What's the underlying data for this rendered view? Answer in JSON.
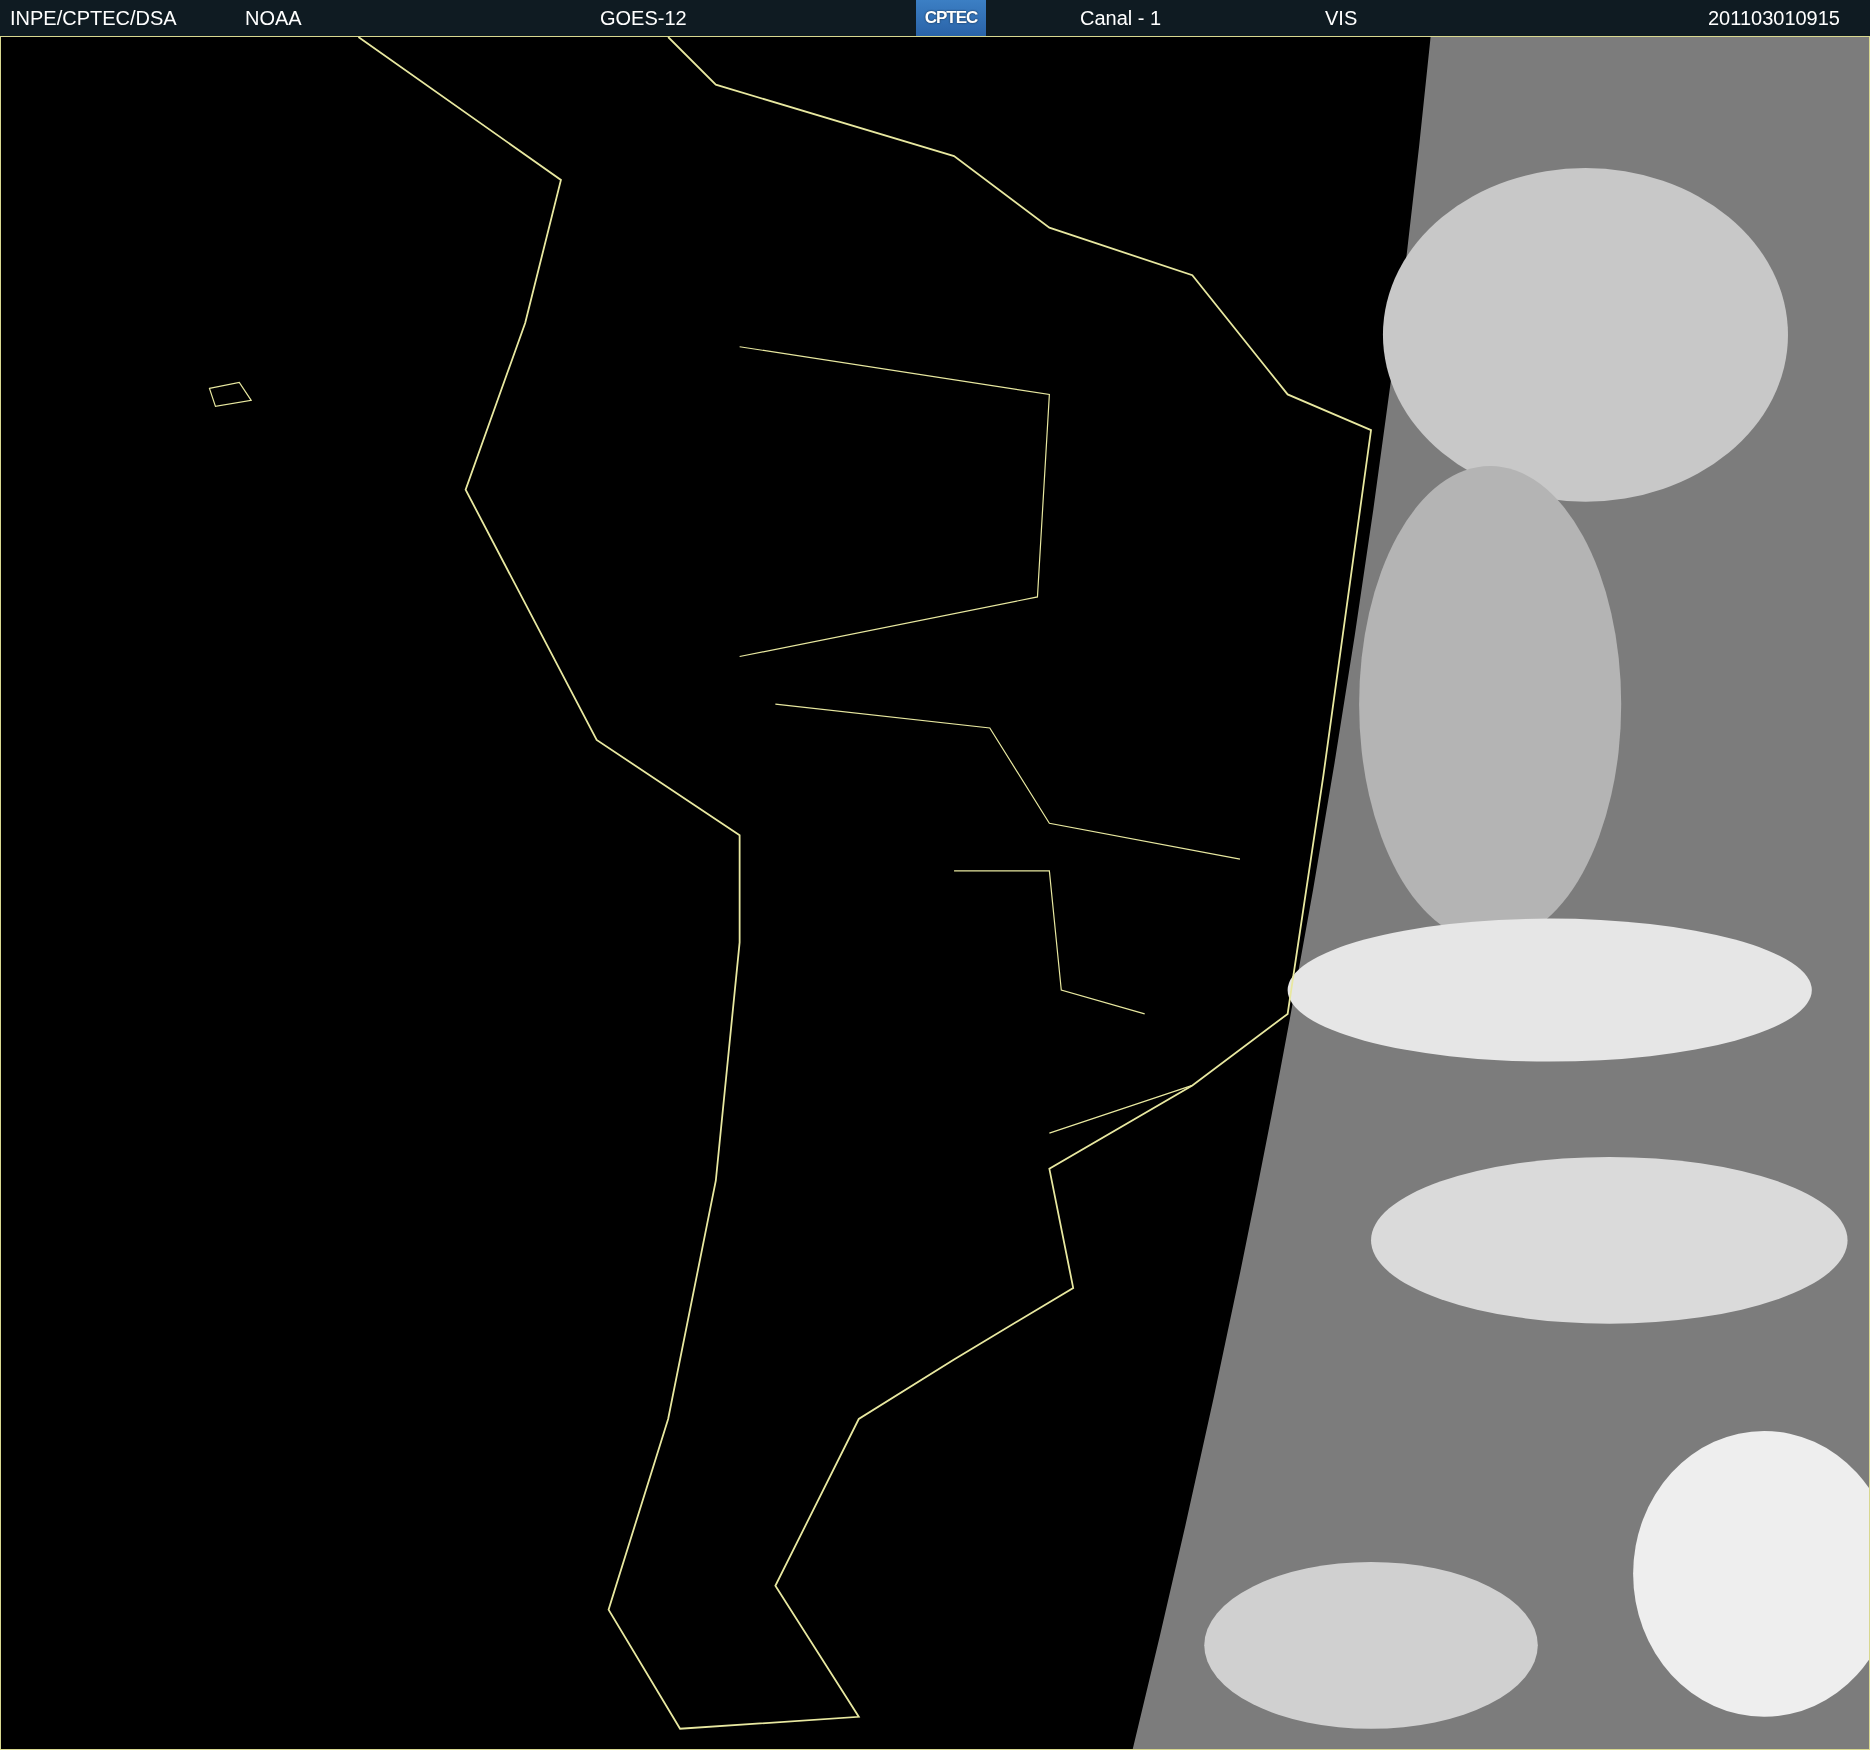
{
  "header": {
    "items": [
      {
        "kind": "text",
        "text": "INPE/CPTEC/DSA"
      },
      {
        "kind": "text",
        "text": "NOAA"
      },
      {
        "kind": "text",
        "text": "GOES-12"
      },
      {
        "kind": "logo",
        "text": "CPTEC"
      },
      {
        "kind": "text",
        "text": "Canal - 1"
      },
      {
        "kind": "text",
        "text": "VIS"
      },
      {
        "kind": "text",
        "text": "201103010915"
      }
    ]
  }
}
